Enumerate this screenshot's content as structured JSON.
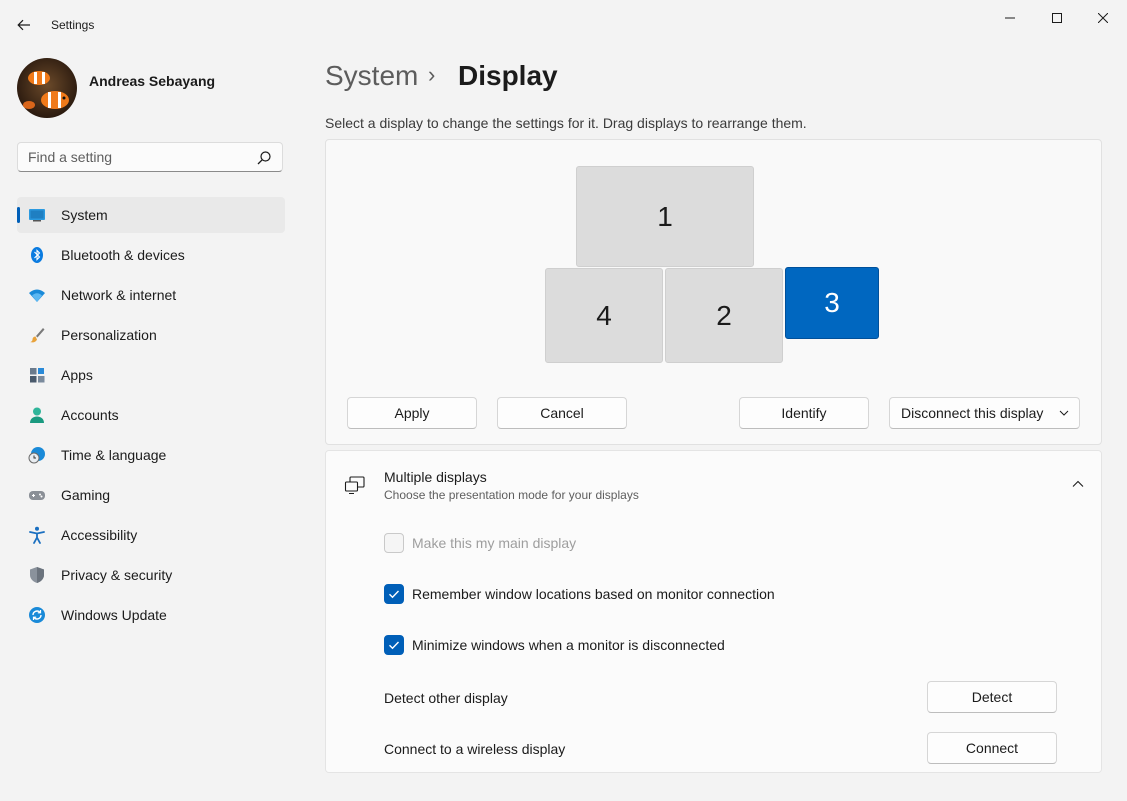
{
  "window": {
    "title": "Settings"
  },
  "user": {
    "name": "Andreas Sebayang"
  },
  "search": {
    "placeholder": "Find a setting"
  },
  "sidebar": {
    "items": [
      {
        "label": "System",
        "icon": "monitor-icon",
        "selected": true
      },
      {
        "label": "Bluetooth & devices",
        "icon": "bluetooth-icon"
      },
      {
        "label": "Network & internet",
        "icon": "wifi-icon"
      },
      {
        "label": "Personalization",
        "icon": "brush-icon"
      },
      {
        "label": "Apps",
        "icon": "apps-icon"
      },
      {
        "label": "Accounts",
        "icon": "person-icon"
      },
      {
        "label": "Time & language",
        "icon": "globe-clock-icon"
      },
      {
        "label": "Gaming",
        "icon": "gamepad-icon"
      },
      {
        "label": "Accessibility",
        "icon": "accessibility-icon"
      },
      {
        "label": "Privacy & security",
        "icon": "shield-icon"
      },
      {
        "label": "Windows Update",
        "icon": "update-icon"
      }
    ]
  },
  "breadcrumb": {
    "parent": "System",
    "separator": "›",
    "current": "Display"
  },
  "arrangement": {
    "description": "Select a display to change the settings for it. Drag displays to rearrange them.",
    "monitors": [
      "1",
      "4",
      "2",
      "3"
    ],
    "selected_monitor": "3",
    "apply_label": "Apply",
    "cancel_label": "Cancel",
    "identify_label": "Identify",
    "disconnect_label": "Disconnect this display"
  },
  "multiple_displays": {
    "title": "Multiple displays",
    "subtitle": "Choose the presentation mode for your displays",
    "main_display": {
      "label": "Make this my main display",
      "checked": false,
      "disabled": true
    },
    "remember_locations": {
      "label": "Remember window locations based on monitor connection",
      "checked": true
    },
    "minimize_windows": {
      "label": "Minimize windows when a monitor is disconnected",
      "checked": true
    },
    "detect": {
      "label": "Detect other display",
      "button": "Detect"
    },
    "connect": {
      "label": "Connect to a wireless display",
      "button": "Connect"
    }
  },
  "colors": {
    "accent": "#005fb8",
    "selected_monitor": "#0067c0",
    "background": "#f3f3f3"
  }
}
